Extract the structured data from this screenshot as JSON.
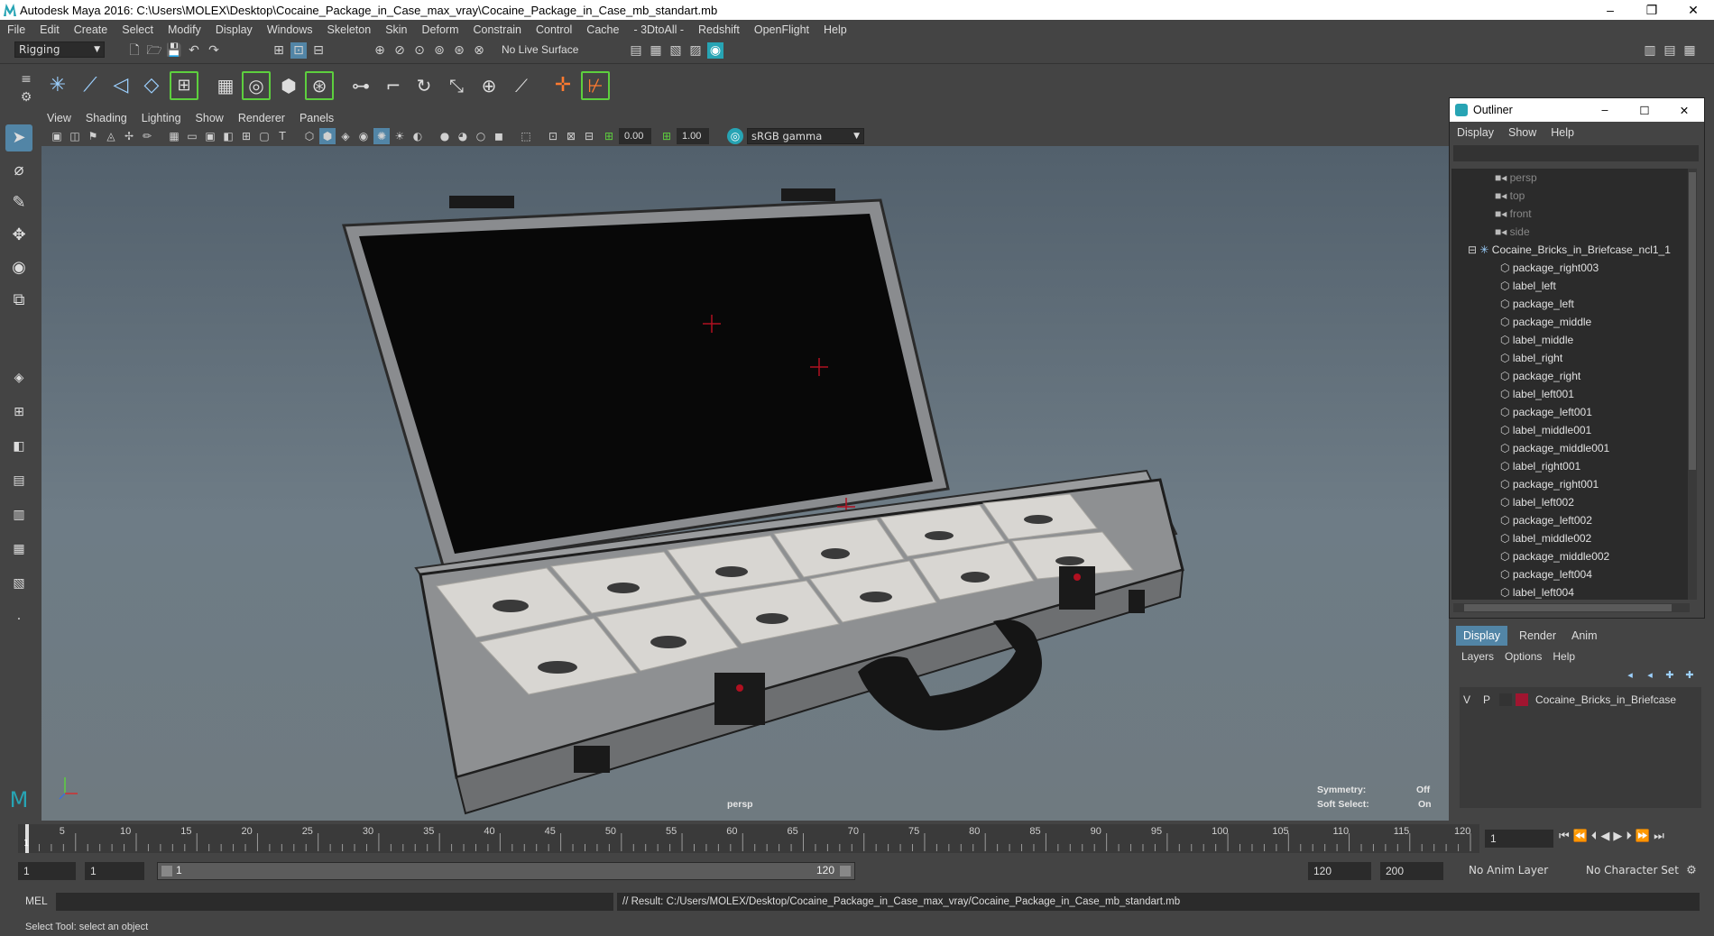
{
  "app": {
    "title": "Autodesk Maya 2016: C:\\Users\\MOLEX\\Desktop\\Cocaine_Package_in_Case_max_vray\\Cocaine_Package_in_Case_mb_standart.mb",
    "window_buttons": [
      "–",
      "❐",
      "✕"
    ]
  },
  "menubar": [
    "File",
    "Edit",
    "Create",
    "Select",
    "Modify",
    "Display",
    "Windows",
    "Skeleton",
    "Skin",
    "Deform",
    "Constrain",
    "Control",
    "Cache",
    "- 3DtoAll -",
    "Redshift",
    "OpenFlight",
    "Help"
  ],
  "status_line": {
    "mode_dropdown": "Rigging",
    "live_surface": "No Live Surface"
  },
  "panel": {
    "menu": [
      "View",
      "Shading",
      "Lighting",
      "Show",
      "Renderer",
      "Panels"
    ],
    "exposure": "0.00",
    "gamma": "1.00",
    "color_space": "sRGB gamma"
  },
  "viewport": {
    "camera_label": "persp",
    "symmetry_label": "Symmetry:",
    "symmetry_value": "Off",
    "soft_select_label": "Soft Select:",
    "soft_select_value": "On"
  },
  "outliner": {
    "title": "Outliner",
    "menu": [
      "Display",
      "Show",
      "Help"
    ],
    "cameras": [
      "persp",
      "top",
      "front",
      "side"
    ],
    "group": "Cocaine_Bricks_in_Briefcase_ncl1_1",
    "children": [
      "package_right003",
      "label_left",
      "package_left",
      "package_middle",
      "label_middle",
      "label_right",
      "package_right",
      "label_left001",
      "package_left001",
      "label_middle001",
      "package_middle001",
      "label_right001",
      "package_right001",
      "label_left002",
      "package_left002",
      "label_middle002",
      "package_middle002",
      "package_left004",
      "label_left004"
    ]
  },
  "layer_editor": {
    "tabs": [
      "Display",
      "Render",
      "Anim"
    ],
    "menu": [
      "Layers",
      "Options",
      "Help"
    ],
    "layer": {
      "v": "V",
      "p": "P",
      "name": "Cocaine_Bricks_in_Briefcase",
      "color": "#a01530"
    }
  },
  "timeline": {
    "ticks": [
      "5",
      "10",
      "15",
      "20",
      "25",
      "30",
      "35",
      "40",
      "45",
      "50",
      "55",
      "60",
      "65",
      "70",
      "75",
      "80",
      "85",
      "90",
      "95",
      "100",
      "105",
      "110",
      "115",
      "120"
    ],
    "start_marker": "1",
    "current_frame": "1"
  },
  "range": {
    "start": "1",
    "playback_start": "1",
    "slider_start": "1",
    "slider_end": "120",
    "playback_end": "120",
    "end": "200",
    "anim_layer": "No Anim Layer",
    "character_set": "No Character Set"
  },
  "command_line": {
    "language": "MEL",
    "result": "// Result: C:/Users/MOLEX/Desktop/Cocaine_Package_in_Case_max_vray/Cocaine_Package_in_Case_mb_standart.mb"
  },
  "help_line": "Select Tool: select an object",
  "colors": {
    "accent": "#27a4b4",
    "active_tab": "#5285a6",
    "layer_color": "#a01530"
  }
}
